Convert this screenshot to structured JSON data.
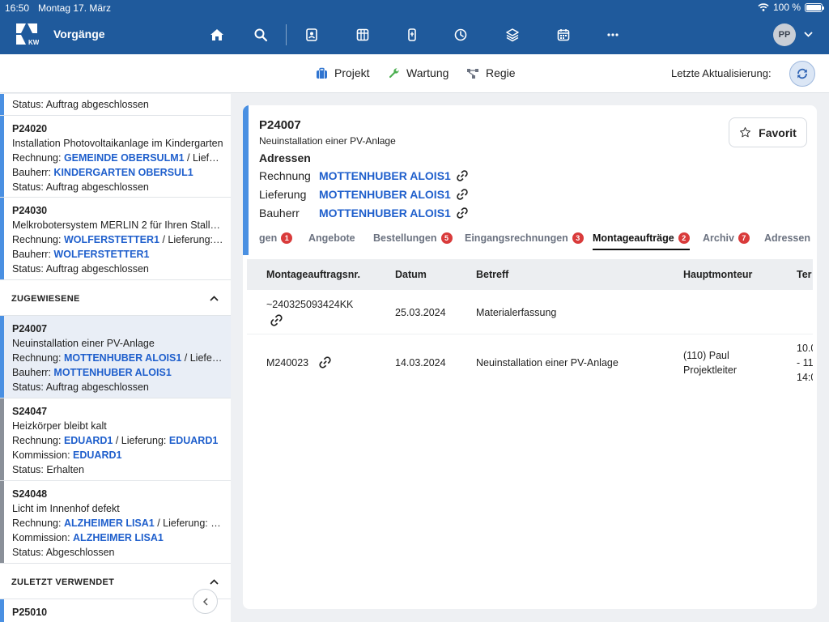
{
  "status_bar": {
    "time": "16:50",
    "date": "Montag 17. März",
    "battery": "100 %"
  },
  "nav": {
    "title": "Vorgänge",
    "logo_text": "KWP",
    "avatar_initials": "PP"
  },
  "subheader": {
    "tabs": [
      {
        "label": "Projekt",
        "icon": "briefcase-icon",
        "color": "#2f74d0"
      },
      {
        "label": "Wartung",
        "icon": "wrench-icon",
        "color": "#4caf50"
      },
      {
        "label": "Regie",
        "icon": "nodes-icon",
        "color": "#6b7280"
      }
    ],
    "last_update_label": "Letzte Aktualisierung:"
  },
  "sidebar": {
    "top_items": [
      {
        "status": "Status: Auftrag abgeschlossen",
        "bar_color": "#4a90e2"
      },
      {
        "code": "P24020",
        "title": "Installation Photovoltaikanlage im Kindergarten",
        "rechnung_label": "Rechnung: ",
        "rechnung": "GEMEINDE OBERSULM1",
        "lieferung_label": " / Lieferun…",
        "bauherr_label": "Bauherr: ",
        "bauherr": "KINDERGARTEN OBERSUL1",
        "status": "Status: Auftrag abgeschlossen",
        "bar_color": "#4a90e2"
      },
      {
        "code": "P24030",
        "title": "Melkrobotersystem MERLIN 2 für Ihren Stallne…",
        "rechnung_label": "Rechnung: ",
        "rechnung": "WOLFERSTETTER1",
        "lieferung_label": " / Lieferung: ",
        "lieferung": "W…",
        "bauherr_label": "Bauherr: ",
        "bauherr": "WOLFERSTETTER1",
        "status": "Status: Auftrag abgeschlossen",
        "bar_color": "#4a90e2"
      }
    ],
    "section_assigned": "ZUGEWIESENE",
    "assigned_items": [
      {
        "code": "P24007",
        "title": "Neuinstallation einer PV-Anlage",
        "rechnung_label": "Rechnung: ",
        "rechnung": "MOTTENHUBER ALOIS1",
        "lieferung_label": " / Lieferun…",
        "bauherr_label": "Bauherr: ",
        "bauherr": "MOTTENHUBER ALOIS1",
        "status": "Status: Auftrag abgeschlossen",
        "bar_color": "#4a90e2"
      },
      {
        "code": "S24047",
        "title": "Heizkörper bleibt kalt",
        "rechnung_label": "Rechnung: ",
        "rechnung": "EDUARD1",
        "lieferung_label": " / Lieferung: ",
        "lieferung": "EDUARD1",
        "kommission_label": "Kommission: ",
        "kommission": "EDUARD1",
        "status": "Status: Erhalten",
        "bar_color": "#8a9099"
      },
      {
        "code": "S24048",
        "title": "Licht im Innenhof defekt",
        "rechnung_label": "Rechnung: ",
        "rechnung": "ALZHEIMER LISA1",
        "lieferung_label": " / Lieferung: ",
        "lieferung": "AL…",
        "kommission_label": "Kommission: ",
        "kommission": "ALZHEIMER LISA1",
        "status": "Status: Abgeschlossen",
        "bar_color": "#8a9099"
      }
    ],
    "section_recent": "ZULETZT VERWENDET",
    "recent_items": [
      {
        "code": "P25010",
        "bar_color": "#4a90e2"
      }
    ]
  },
  "detail": {
    "code": "P24007",
    "subtitle": "Neuinstallation einer PV-Anlage",
    "favorite_label": "Favorit",
    "addresses_heading": "Adressen",
    "addresses": [
      {
        "label": "Rechnung",
        "value": "MOTTENHUBER ALOIS1"
      },
      {
        "label": "Lieferung",
        "value": "MOTTENHUBER ALOIS1"
      },
      {
        "label": "Bauherr",
        "value": "MOTTENHUBER ALOIS1"
      }
    ],
    "tabs": [
      {
        "label": "gen",
        "badge": "1"
      },
      {
        "label": "Angebote",
        "badge": ""
      },
      {
        "label": "Bestellungen",
        "badge": "5"
      },
      {
        "label": "Eingangsrechnungen",
        "badge": "3"
      },
      {
        "label": "Montageaufträge",
        "badge": "2",
        "active": true
      },
      {
        "label": "Archiv",
        "badge": "7"
      },
      {
        "label": "Adressen",
        "badge": ""
      }
    ],
    "table": {
      "columns": [
        "Montageauftragsnr.",
        "Datum",
        "Betreff",
        "Hauptmonteur",
        "Ter"
      ],
      "rows": [
        {
          "nr": "~240325093424KK",
          "datum": "25.03.2024",
          "betreff": "Materialerfassung",
          "monteur_1": "",
          "monteur_2": "",
          "termin_1": "",
          "termin_2": "",
          "termin_3": ""
        },
        {
          "nr": "M240023",
          "datum": "14.03.2024",
          "betreff": "Neuinstallation einer PV-Anlage",
          "monteur_1": "(110) Paul",
          "monteur_2": "Projektleiter",
          "termin_1": "10.0",
          "termin_2": "- 11",
          "termin_3": "14:0"
        }
      ]
    }
  }
}
